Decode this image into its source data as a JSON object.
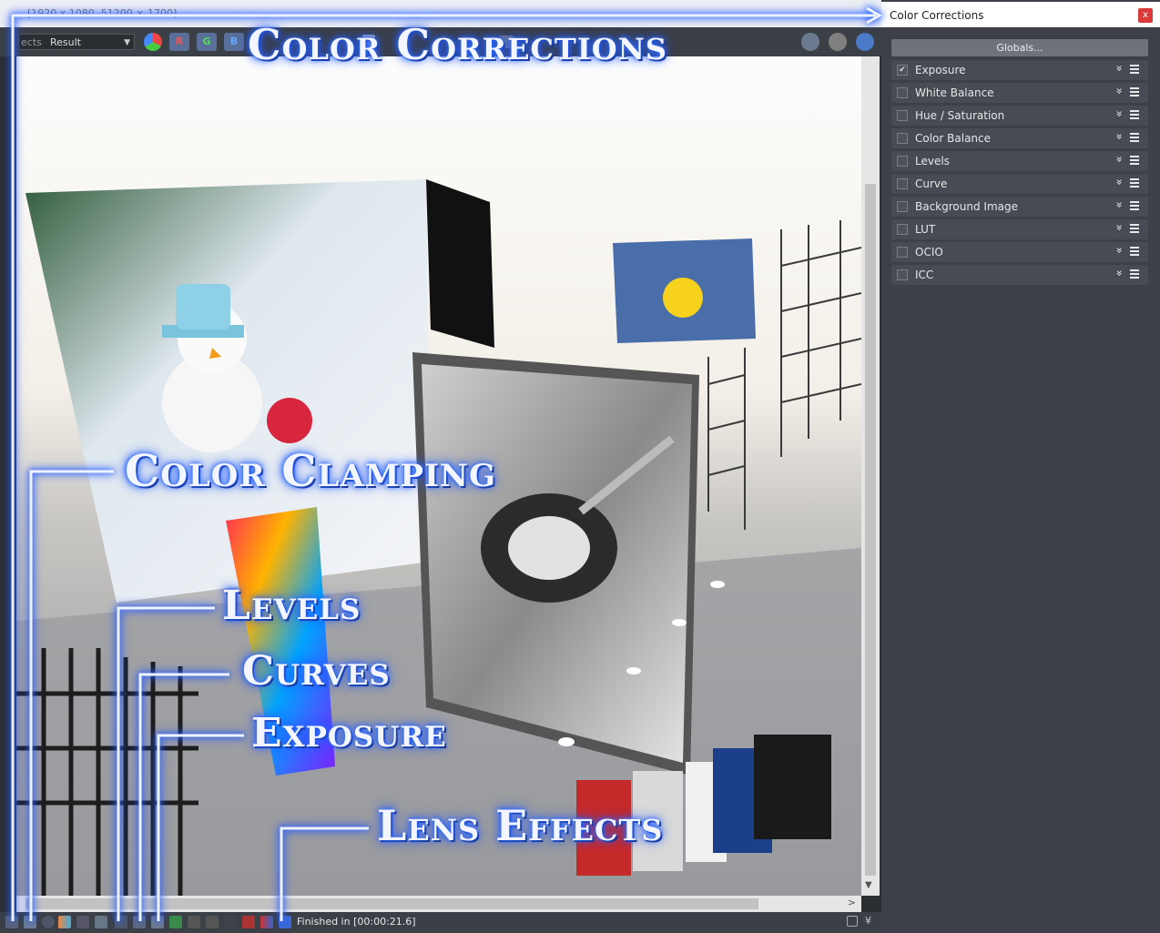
{
  "frame_buffer": {
    "title": "[1920 x 1080, 51200 × 1700]",
    "toolbar": {
      "channel_select": "Result",
      "channel_prefix": "ects",
      "buttons": [
        "R",
        "G",
        "B"
      ]
    },
    "status": "Finished in [00:00:21.6]"
  },
  "annotations": {
    "color_corrections": "Color Corrections",
    "color_clamping": "Color Clamping",
    "levels": "Levels",
    "curves": "Curves",
    "exposure": "Exposure",
    "lens_effects": "Lens Effects"
  },
  "panel": {
    "title": "Color Corrections",
    "close": "x",
    "globals_button": "Globals...",
    "items": [
      {
        "label": "Exposure",
        "checked": true
      },
      {
        "label": "White Balance",
        "checked": false
      },
      {
        "label": "Hue / Saturation",
        "checked": false
      },
      {
        "label": "Color Balance",
        "checked": false
      },
      {
        "label": "Levels",
        "checked": false
      },
      {
        "label": "Curve",
        "checked": false
      },
      {
        "label": "Background Image",
        "checked": false
      },
      {
        "label": "LUT",
        "checked": false
      },
      {
        "label": "OCIO",
        "checked": false
      },
      {
        "label": "ICC",
        "checked": false
      }
    ]
  },
  "colors": {
    "accent_blue": "#2f6bff",
    "panel_bg": "#3d4048",
    "close_red": "#d93a3a"
  }
}
